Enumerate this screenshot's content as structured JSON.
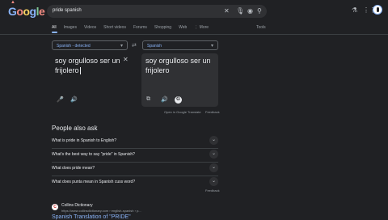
{
  "logo": {
    "g": "G",
    "o1": "o",
    "o2": "o",
    "g2": "g",
    "l": "l",
    "e": "e"
  },
  "search": {
    "query": "pride spanish"
  },
  "header_icons": [
    "clear-icon",
    "mic-icon",
    "lens-icon",
    "search-icon",
    "labs-icon",
    "apps-icon"
  ],
  "tabs": [
    {
      "label": "All",
      "active": true
    },
    {
      "label": "Images"
    },
    {
      "label": "Videos"
    },
    {
      "label": "Short videos"
    },
    {
      "label": "Forums"
    },
    {
      "label": "Shopping"
    },
    {
      "label": "Web"
    },
    {
      "label": "⋮ More"
    }
  ],
  "tools": "Tools",
  "translate": {
    "source_lang": "Spanish - detected",
    "target_lang": "Spanish",
    "source_text": "soy orgulloso ser un frijolero",
    "target_text": "soy orgulloso ser un frijolero",
    "open_link": "Open in Google Translate",
    "feedback": "Feedback"
  },
  "paa": {
    "title": "People also ask",
    "questions": [
      "What is pride in Spanish to English?",
      "What's the best way to say \"pride\" in Spanish?",
      "What does pride mean?",
      "What does punta mean in Spanish cuss word?"
    ],
    "feedback": "Feedback"
  },
  "result": {
    "favicon": "C",
    "site": "Collins Dictionary",
    "url": "https://www.collinsdictionary.com › english-spanish › p...",
    "title": "Spanish Translation of \"PRIDE\""
  }
}
